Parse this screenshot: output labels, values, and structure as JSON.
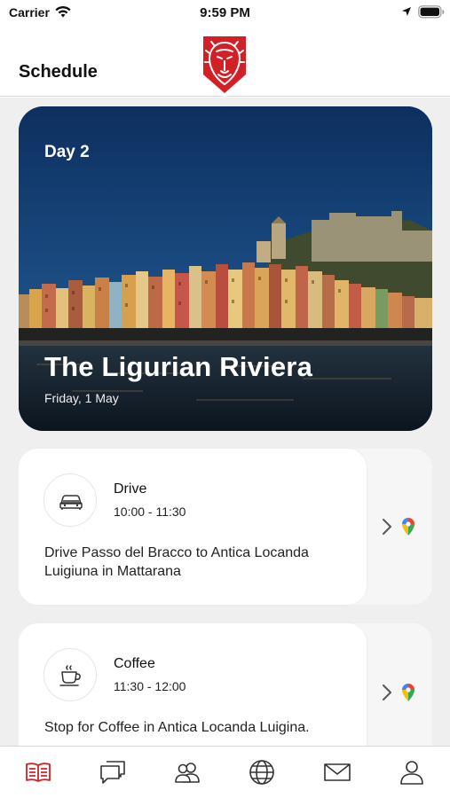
{
  "status_bar": {
    "carrier": "Carrier",
    "time": "9:59 PM"
  },
  "header": {
    "title": "Schedule",
    "logo_icon": "lion-shield-logo",
    "logo_color": "#d32027"
  },
  "hero": {
    "day_label": "Day 2",
    "title": "The Ligurian Riviera",
    "date": "Friday, 1 May"
  },
  "activities": [
    {
      "icon": "car-icon",
      "title": "Drive",
      "time": "10:00 - 11:30",
      "description": "Drive Passo del Bracco to Antica Locanda Luigiuna in Mattarana"
    },
    {
      "icon": "coffee-cup-icon",
      "title": "Coffee",
      "time": "11:30 - 12:00",
      "description": "Stop for Coffee in Antica Locanda Luigina."
    }
  ],
  "tab_bar": {
    "active_color": "#d32027",
    "inactive_color": "#333333",
    "tabs": [
      {
        "icon": "book-icon",
        "active": true
      },
      {
        "icon": "chat-icon",
        "active": false
      },
      {
        "icon": "people-icon",
        "active": false
      },
      {
        "icon": "globe-icon",
        "active": false
      },
      {
        "icon": "mail-icon",
        "active": false
      },
      {
        "icon": "profile-icon",
        "active": false
      }
    ]
  }
}
